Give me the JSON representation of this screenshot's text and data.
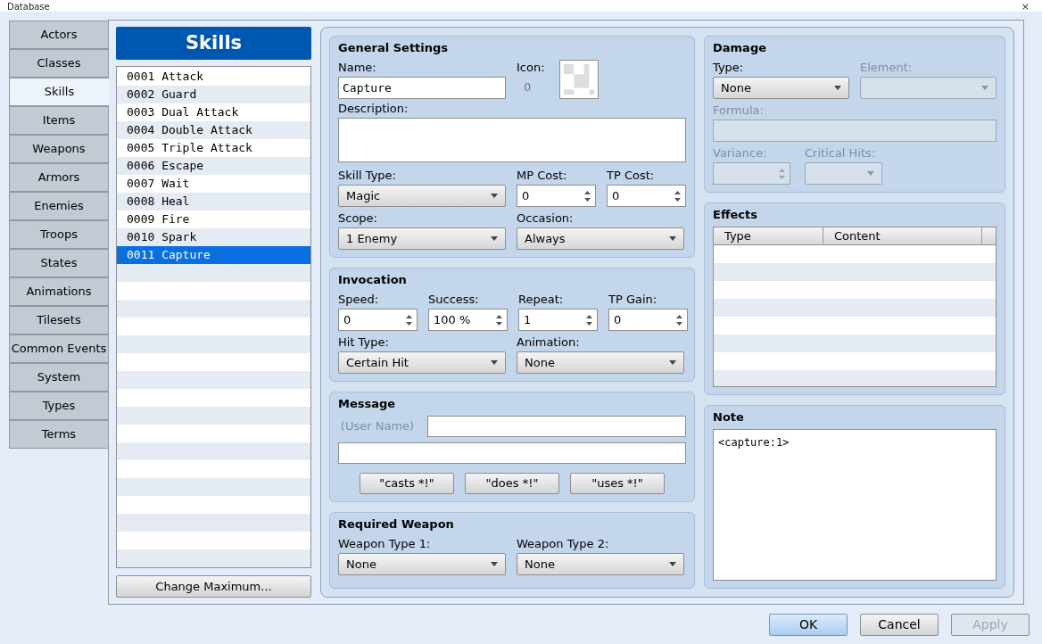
{
  "window": {
    "title": "Database",
    "close": "×"
  },
  "tabs": [
    {
      "label": "Actors",
      "selected": false
    },
    {
      "label": "Classes",
      "selected": false
    },
    {
      "label": "Skills",
      "selected": true
    },
    {
      "label": "Items",
      "selected": false
    },
    {
      "label": "Weapons",
      "selected": false
    },
    {
      "label": "Armors",
      "selected": false
    },
    {
      "label": "Enemies",
      "selected": false
    },
    {
      "label": "Troops",
      "selected": false
    },
    {
      "label": "States",
      "selected": false
    },
    {
      "label": "Animations",
      "selected": false
    },
    {
      "label": "Tilesets",
      "selected": false
    },
    {
      "label": "Common Events",
      "selected": false
    },
    {
      "label": "System",
      "selected": false
    },
    {
      "label": "Types",
      "selected": false
    },
    {
      "label": "Terms",
      "selected": false
    }
  ],
  "list": {
    "title": "Skills",
    "items": [
      {
        "label": "0001 Attack",
        "selected": false
      },
      {
        "label": "0002 Guard",
        "selected": false
      },
      {
        "label": "0003 Dual Attack",
        "selected": false
      },
      {
        "label": "0004 Double Attack",
        "selected": false
      },
      {
        "label": "0005 Triple Attack",
        "selected": false
      },
      {
        "label": "0006 Escape",
        "selected": false
      },
      {
        "label": "0007 Wait",
        "selected": false
      },
      {
        "label": "0008 Heal",
        "selected": false
      },
      {
        "label": "0009 Fire",
        "selected": false
      },
      {
        "label": "0010 Spark",
        "selected": false
      },
      {
        "label": "0011 Capture",
        "selected": true
      }
    ],
    "button": "Change Maximum..."
  },
  "general": {
    "title": "General Settings",
    "name": {
      "label": "Name:",
      "value": "Capture"
    },
    "icon": {
      "label": "Icon:",
      "index": "0"
    },
    "description": {
      "label": "Description:"
    },
    "skill_type": {
      "label": "Skill Type:",
      "value": "Magic"
    },
    "mp_cost": {
      "label": "MP Cost:",
      "value": "0"
    },
    "tp_cost": {
      "label": "TP Cost:",
      "value": "0"
    },
    "scope": {
      "label": "Scope:",
      "value": "1 Enemy"
    },
    "occasion": {
      "label": "Occasion:",
      "value": "Always"
    }
  },
  "invocation": {
    "title": "Invocation",
    "speed": {
      "label": "Speed:",
      "value": "0"
    },
    "success": {
      "label": "Success:",
      "value": "100 %"
    },
    "repeat": {
      "label": "Repeat:",
      "value": "1"
    },
    "tp_gain": {
      "label": "TP Gain:",
      "value": "0"
    },
    "hit_type": {
      "label": "Hit Type:",
      "value": "Certain Hit"
    },
    "animation": {
      "label": "Animation:",
      "value": "None"
    }
  },
  "message": {
    "title": "Message",
    "user_name": "(User Name)",
    "buttons": [
      "\"casts *!\"",
      "\"does *!\"",
      "\"uses *!\""
    ]
  },
  "required_weapon": {
    "title": "Required Weapon",
    "weapon_type_1": {
      "label": "Weapon Type 1:",
      "value": "None"
    },
    "weapon_type_2": {
      "label": "Weapon Type 2:",
      "value": "None"
    }
  },
  "damage": {
    "title": "Damage",
    "type": {
      "label": "Type:",
      "value": "None",
      "disabled": false
    },
    "element": {
      "label": "Element:",
      "disabled": true
    },
    "formula": {
      "label": "Formula:",
      "disabled": true
    },
    "variance": {
      "label": "Variance:",
      "disabled": true
    },
    "critical_hits": {
      "label": "Critical Hits:",
      "disabled": true
    }
  },
  "effects": {
    "title": "Effects",
    "columns": [
      "Type",
      "Content"
    ]
  },
  "note": {
    "title": "Note",
    "value": "<capture:1>"
  },
  "buttons": [
    {
      "label": "OK",
      "default": true,
      "disabled": false
    },
    {
      "label": "Cancel",
      "default": false,
      "disabled": false
    },
    {
      "label": "Apply",
      "default": false,
      "disabled": true
    }
  ]
}
